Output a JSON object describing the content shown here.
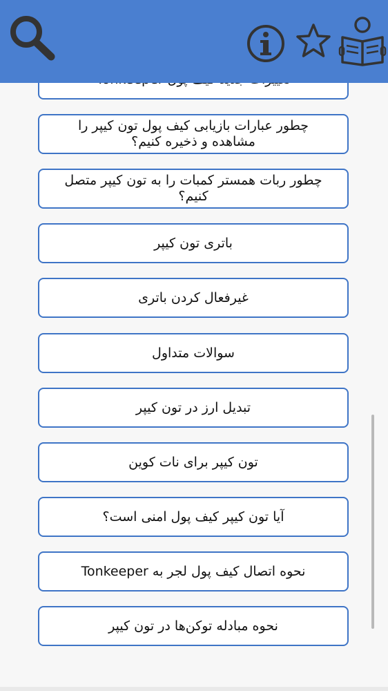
{
  "header": {
    "icons": {
      "search": "search-icon",
      "info": "info-icon",
      "star": "star-icon",
      "reader": "reader-book-icon"
    }
  },
  "items": [
    {
      "label": "تغییرات جدید کیف پول Tonkeeper"
    },
    {
      "label": "چطور عبارات بازیابی کیف پول تون کیپر را مشاهده و ذخیره کنیم؟"
    },
    {
      "label": "چطور ربات همستر کمبات را به تون کیپر متصل کنیم؟"
    },
    {
      "label": "باتری تون کیپر"
    },
    {
      "label": "غیرفعال کردن باتری"
    },
    {
      "label": "سوالات متداول"
    },
    {
      "label": "تبدیل ارز در تون کیپر"
    },
    {
      "label": "تون کیپر برای نات کوین"
    },
    {
      "label": "آیا تون کیپر کیف پول امنی است؟"
    },
    {
      "label": "نحوه اتصال کیف پول لجر به Tonkeeper"
    },
    {
      "label": "نحوه مبادله توکن‌ها در تون کیپر"
    }
  ],
  "colors": {
    "header": "#4a7fd0",
    "border": "#3e74c6",
    "icon": "#333333",
    "background": "#f7f7f7"
  }
}
